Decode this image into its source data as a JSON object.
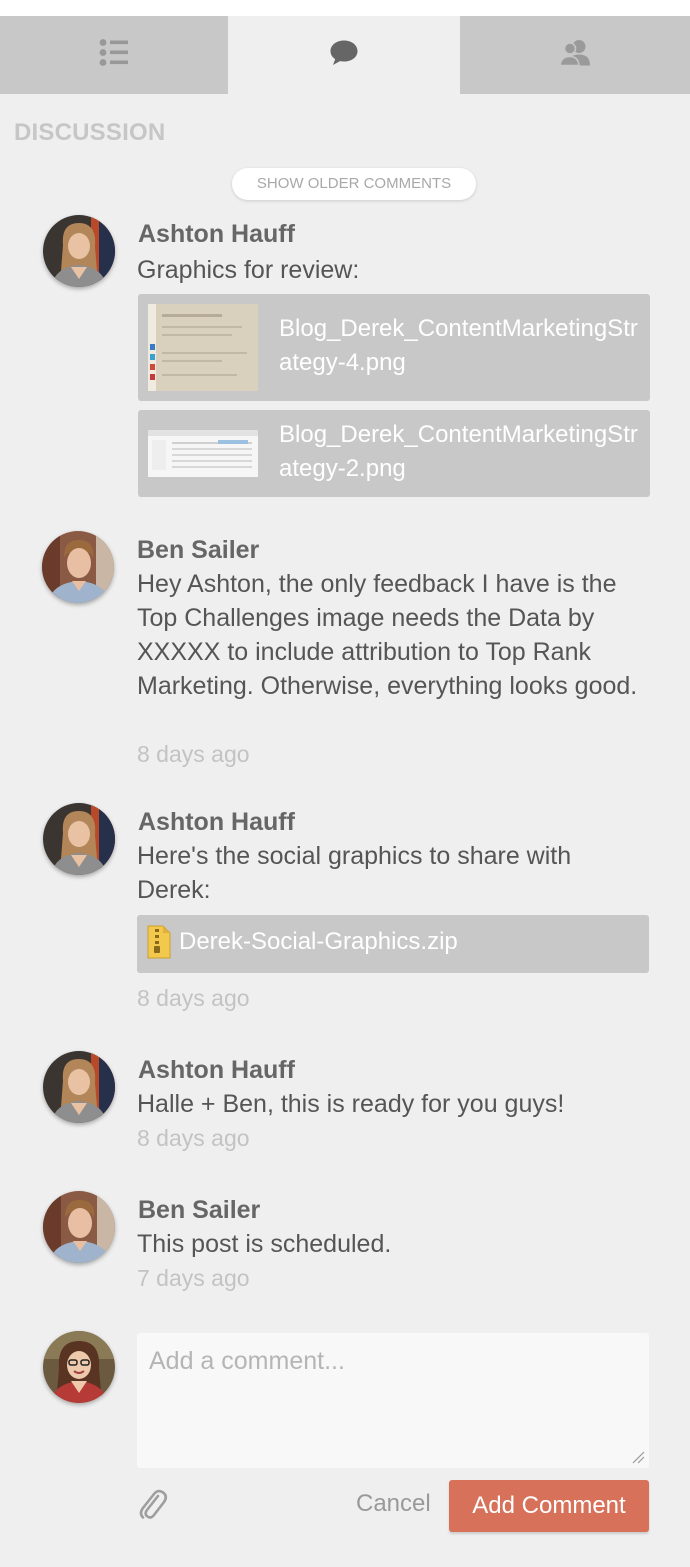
{
  "tabs": [
    {
      "icon": "list-icon"
    },
    {
      "icon": "comment-icon"
    },
    {
      "icon": "users-icon"
    }
  ],
  "section_title": "DISCUSSION",
  "show_older_label": "SHOW OLDER COMMENTS",
  "comments": [
    {
      "author": "Ashton Hauff",
      "text": "Graphics for review:",
      "attachments": [
        {
          "name": "Blog_Derek_ContentMarketingStrategy-4.png"
        },
        {
          "name": "Blog_Derek_ContentMarketingStrategy-2.png"
        }
      ]
    },
    {
      "author": "Ben Sailer",
      "text": "Hey Ashton, the only feedback I have is the Top Challenges image needs the Data by XXXXX to include attribution to Top Rank Marketing. Otherwise, everything looks good.",
      "time": "8 days ago"
    },
    {
      "author": "Ashton Hauff",
      "text": "Here's the social graphics to share with Derek:",
      "attachments": [
        {
          "name": "Derek-Social-Graphics.zip"
        }
      ],
      "time": "8 days ago"
    },
    {
      "author": "Ashton Hauff",
      "text": "Halle + Ben, this is ready for you guys!",
      "time": "8 days ago"
    },
    {
      "author": "Ben Sailer",
      "text": "This post is scheduled.",
      "time": "7 days ago"
    }
  ],
  "composer": {
    "placeholder": "Add a comment...",
    "cancel_label": "Cancel",
    "submit_label": "Add Comment"
  },
  "colors": {
    "accent": "#d8715a",
    "tab_bg": "#c8c8c8",
    "page_bg": "#efefef"
  }
}
